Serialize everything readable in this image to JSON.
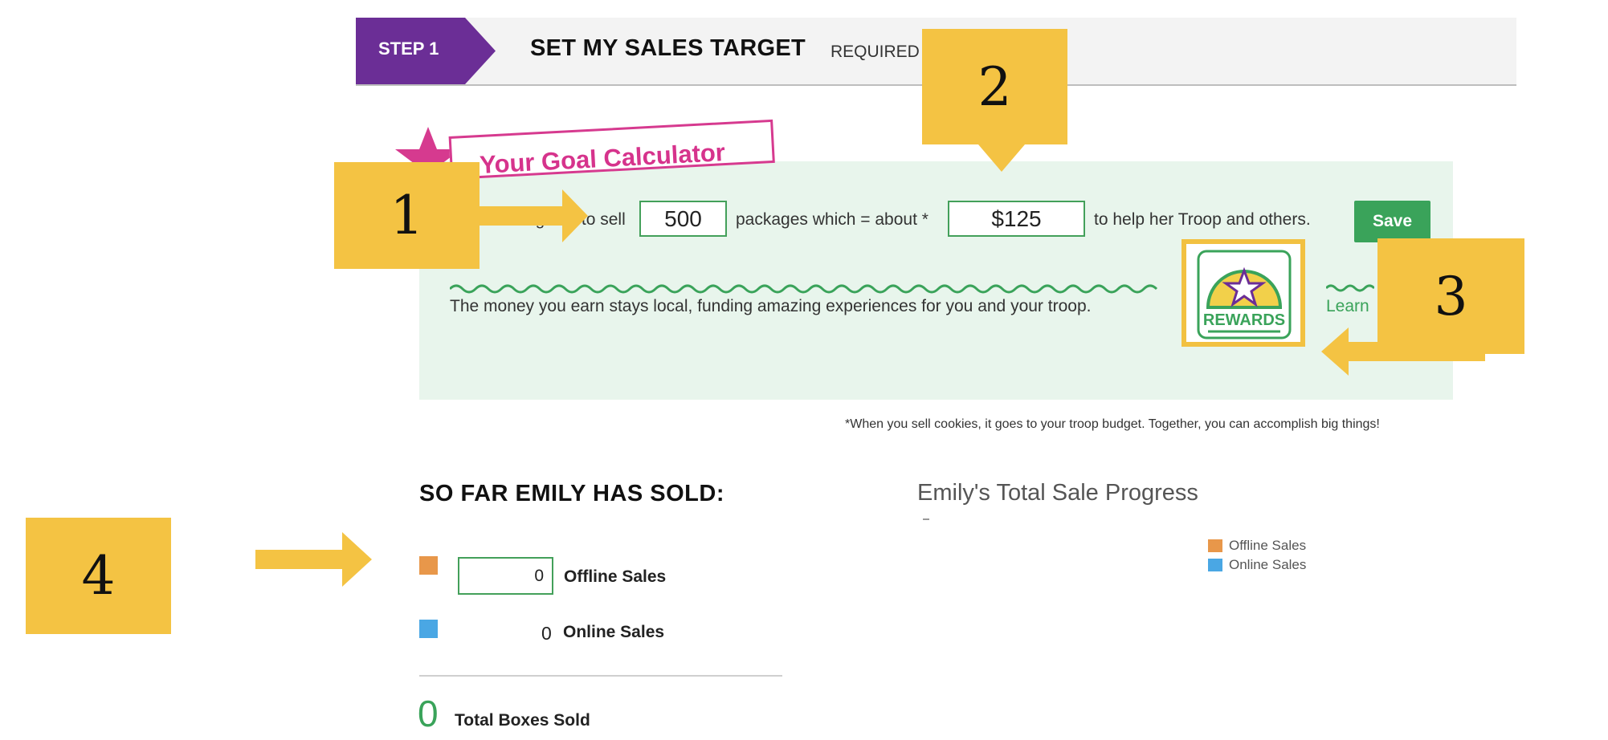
{
  "step": {
    "badge": "STEP 1",
    "title": "SET MY SALES TARGET",
    "required": "REQUIRED"
  },
  "calculator": {
    "banner_title": "Your Goal Calculator",
    "sentence_start": "I am going to sell",
    "packages_value": "500",
    "sentence_mid": "packages which = about *",
    "dollar_value": "$125",
    "sentence_end": "to help her Troop and others.",
    "save_label": "Save",
    "money_text": "The money you earn stays local, funding amazing experiences for you and your troop.",
    "rewards_label": "REWARDS",
    "learn_label": "Learn",
    "footnote": "*When you sell cookies, it goes to your troop budget. Together, you can accomplish big things!"
  },
  "sold": {
    "title": "SO FAR EMILY HAS SOLD:",
    "offline_value": "0",
    "offline_label": "Offline Sales",
    "online_value": "0",
    "online_label": "Online Sales",
    "total_value": "0",
    "total_label": "Total Boxes Sold",
    "offline_color": "#e8974a",
    "online_color": "#4aa7e4"
  },
  "chart": {
    "title": "Emily's Total Sale Progress",
    "legend": [
      {
        "label": "Offline Sales",
        "color": "#e8974a"
      },
      {
        "label": "Online Sales",
        "color": "#4aa7e4"
      }
    ]
  },
  "chart_data": {
    "type": "pie",
    "title": "Emily's Total Sale Progress",
    "categories": [
      "Offline Sales",
      "Online Sales"
    ],
    "values": [
      0,
      0
    ],
    "legend": "right"
  },
  "annotations": {
    "callout_1": "1",
    "callout_2": "2",
    "callout_3": "3",
    "callout_4": "4",
    "color": "#f4c343"
  }
}
